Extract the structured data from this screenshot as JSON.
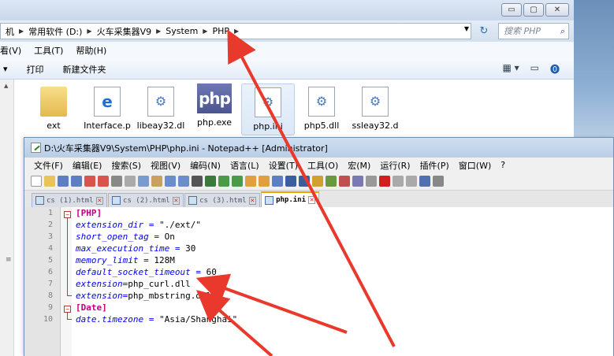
{
  "explorer": {
    "breadcrumbs": [
      "机",
      "常用软件 (D:)",
      "火车采集器V9",
      "System",
      "PHP"
    ],
    "search_placeholder": "搜索 PHP",
    "window_buttons": {
      "minimize": "▭",
      "maximize": "▢",
      "close": "✕"
    },
    "menu": [
      "看(V)",
      "工具(T)",
      "帮助(H)"
    ],
    "toolbar": {
      "dropdown": "▾",
      "print": "打印",
      "new_folder": "新建文件夹"
    },
    "files": [
      {
        "name": "ext",
        "icon": "folder-icon"
      },
      {
        "name": "Interface.p",
        "icon": "ie-icon"
      },
      {
        "name": "libeay32.dl",
        "icon": "gear-file-icon"
      },
      {
        "name": "php.exe",
        "icon": "php-icon"
      },
      {
        "name": "php.ini",
        "icon": "gear-file-icon"
      },
      {
        "name": "php5.dll",
        "icon": "gear-file-icon"
      },
      {
        "name": "ssleay32.d",
        "icon": "gear-file-icon"
      }
    ]
  },
  "notepad": {
    "title": "D:\\火车采集器V9\\System\\PHP\\php.ini - Notepad++ [Administrator]",
    "menu": [
      "文件(F)",
      "编辑(E)",
      "搜索(S)",
      "视图(V)",
      "编码(N)",
      "语言(L)",
      "设置(T)",
      "工具(O)",
      "宏(M)",
      "运行(R)",
      "插件(P)",
      "窗口(W)",
      "?"
    ],
    "tabs": [
      {
        "label": "cs (1).html",
        "active": false
      },
      {
        "label": "cs (2).html",
        "active": false
      },
      {
        "label": "cs (3).html",
        "active": false
      },
      {
        "label": "php.ini",
        "active": true
      }
    ],
    "lines": [
      {
        "n": "1",
        "section": "[PHP]"
      },
      {
        "n": "2",
        "key": "extension_dir",
        "eq": " = ",
        "val": "\"./ext/\""
      },
      {
        "n": "3",
        "key": "short_open_tag",
        "eq": " = ",
        "val": "On"
      },
      {
        "n": "4",
        "key": "max_execution_time",
        "eq": " = ",
        "val": "30"
      },
      {
        "n": "5",
        "key": "memory_limit",
        "eq": " = ",
        "val": "128M"
      },
      {
        "n": "6",
        "key": "default_socket_timeout",
        "eq": " = ",
        "val": "60"
      },
      {
        "n": "7",
        "key": "extension",
        "eq": "=",
        "val": "php_curl.dll"
      },
      {
        "n": "8",
        "key": "extension",
        "eq": "=",
        "val": "php_mbstring.dll"
      },
      {
        "n": "9",
        "section": "[Date]"
      },
      {
        "n": "10",
        "key": "date.timezone",
        "eq": " = ",
        "val": "\"Asia/Shanghai\""
      }
    ]
  },
  "colors": {
    "arrow": "#e8392c",
    "section": "#c00080",
    "key": "#0000ff"
  }
}
